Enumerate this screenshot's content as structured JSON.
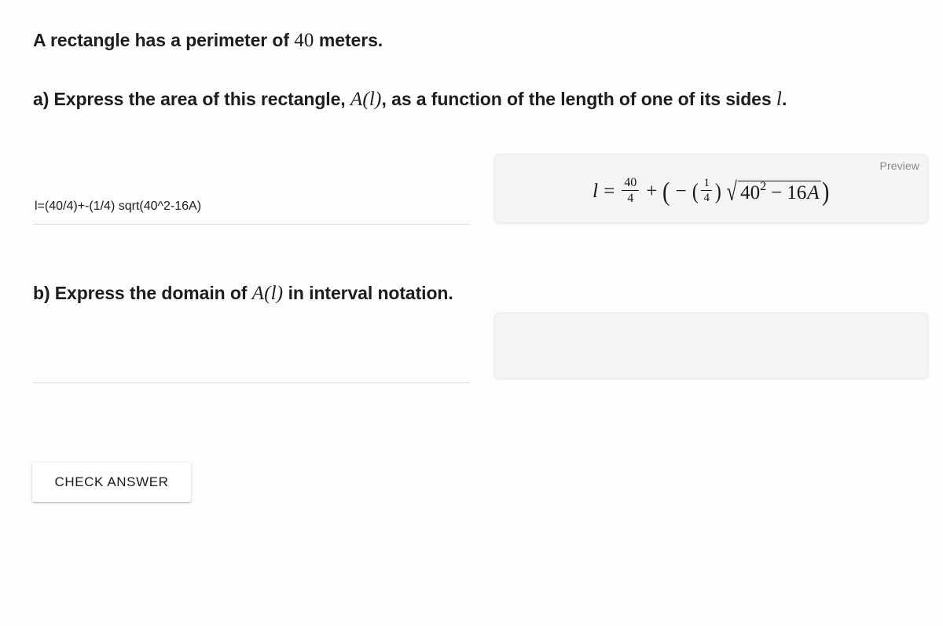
{
  "page": {
    "background": "#fdfdfd",
    "text_color": "#1d1d1d"
  },
  "question": {
    "stem": {
      "before": "A rectangle has a perimeter of ",
      "math": "40",
      "after": " meters."
    },
    "part_a": {
      "segment_1": "a) Express the area of this rectangle, ",
      "math_1": "A(l)",
      "segment_2": ", as a function of the length of one of its sides ",
      "math_2": "l",
      "segment_3": "."
    },
    "part_b": {
      "segment_1": "b) Express the domain of ",
      "math_1": "A(l)",
      "segment_2": " in interval notation."
    }
  },
  "answers": {
    "a": {
      "value": "l=(40/4)+-(1/4) sqrt(40^2-16A)",
      "placeholder": ""
    },
    "b": {
      "value": "",
      "placeholder": ""
    }
  },
  "previews": {
    "a": {
      "label": "Preview",
      "expression_plain": "l = 40/4 + ( - (1/4) sqrt(40^2 - 16A) )",
      "lhs_variable": "l",
      "equals": "=",
      "fraction_1": {
        "numerator": "40",
        "denominator": "4"
      },
      "plus": "+",
      "open_paren": "(",
      "minus": "−",
      "inner_open_paren": "(",
      "fraction_2": {
        "numerator": "1",
        "denominator": "4"
      },
      "inner_close_paren": ")",
      "radical": "√",
      "radicand_base": "40",
      "radicand_exponent": "2",
      "radicand_minus": "−",
      "radicand_term": "16",
      "radicand_variable": "A",
      "close_paren": ")"
    },
    "b": {
      "label": "",
      "expression_plain": ""
    }
  },
  "actions": {
    "check_answer_label": "CHECK ANSWER"
  },
  "colors": {
    "preview_background": "#f4f4f4",
    "preview_border": "#ededed",
    "preview_label": "#8a8a8a",
    "input_underline": "#dedede",
    "button_background": "#ffffff"
  }
}
